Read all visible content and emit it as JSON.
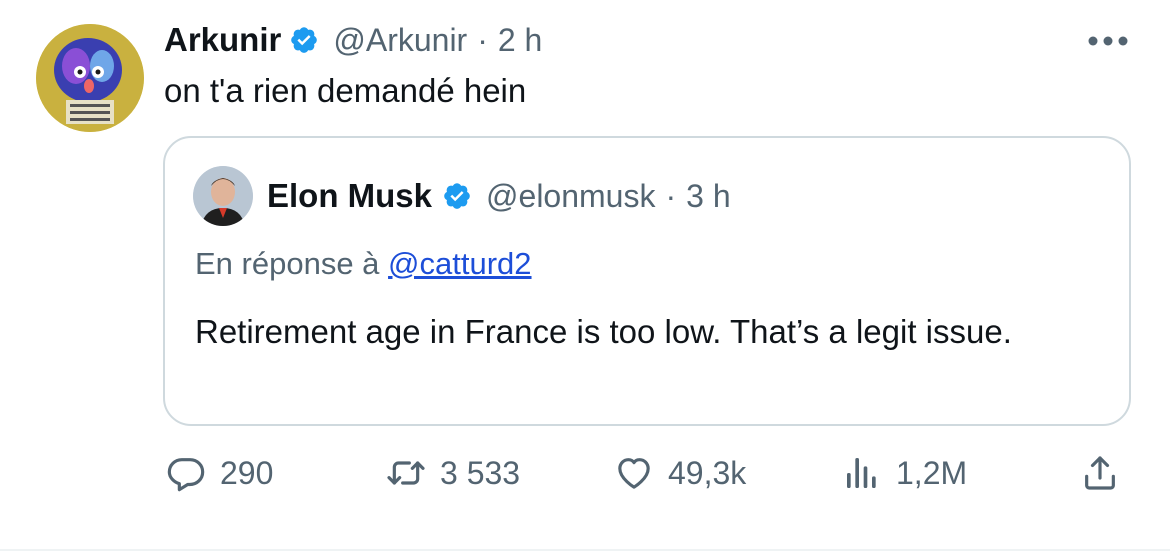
{
  "tweet": {
    "display_name": "Arkunir",
    "handle": "@Arkunir",
    "separator": "·",
    "time": "2 h",
    "text": "on t'a rien demandé hein",
    "verified": true
  },
  "quoted": {
    "display_name": "Elon Musk",
    "handle": "@elonmusk",
    "separator": "·",
    "time": "3 h",
    "reply_prefix": "En réponse à",
    "reply_to": "@catturd2",
    "text": "Retirement age in France is too low. That’s a legit issue.",
    "verified": true
  },
  "actions": {
    "replies": "290",
    "retweets": "3 533",
    "likes": "49,3k",
    "views": "1,2M"
  },
  "icons": {
    "more": "more-horizontal-icon",
    "verified": "verified-badge-icon",
    "reply": "reply-icon",
    "retweet": "retweet-icon",
    "like": "heart-icon",
    "views": "views-icon",
    "share": "share-icon"
  },
  "colors": {
    "text": "#0f1419",
    "secondary": "#536471",
    "verified": "#1d9bf0",
    "link": "#1d4ed8",
    "border": "#cfd9de"
  }
}
